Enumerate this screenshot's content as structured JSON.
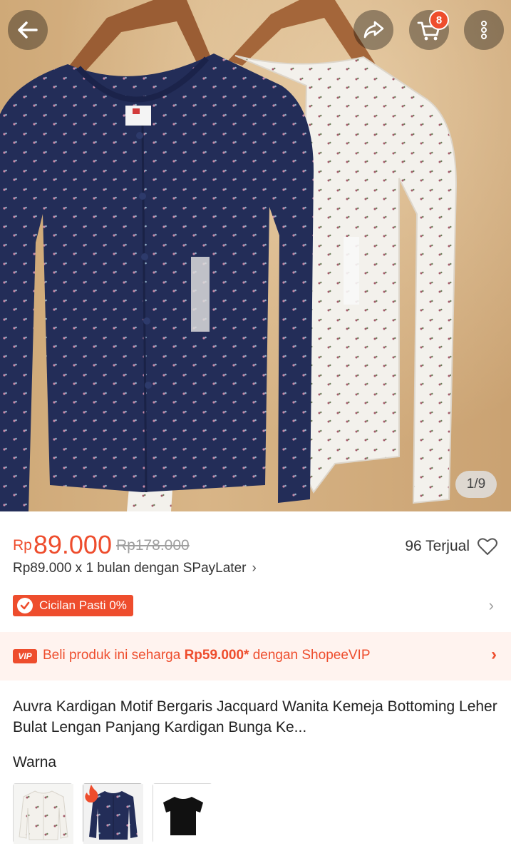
{
  "header": {
    "back_icon": "arrow-left-icon",
    "share_icon": "share-icon",
    "cart_icon": "shopping-cart-icon",
    "cart_count": "8",
    "more_icon": "more-vertical-icon"
  },
  "gallery": {
    "counter": "1/9"
  },
  "price": {
    "currency": "Rp",
    "current": "89.000",
    "original": "Rp178.000",
    "sold": "96 Terjual"
  },
  "paylater": {
    "text": "Rp89.000 x 1 bulan dengan SPayLater"
  },
  "installment": {
    "badge": "Cicilan Pasti 0%"
  },
  "vip": {
    "tag": "VIP",
    "text_before": "Beli produk ini seharga ",
    "price": "Rp59.000*",
    "text_after": " dengan ShopeeVIP"
  },
  "product": {
    "title": "Auvra  Kardigan Motif Bergaris Jacquard Wanita Kemeja Bottoming Leher Bulat Lengan Panjang Kardigan Bunga Ke..."
  },
  "variants": {
    "label": "Warna"
  },
  "colors": {
    "accent": "#ee4d2d",
    "vip_bg": "#fff3ef"
  }
}
